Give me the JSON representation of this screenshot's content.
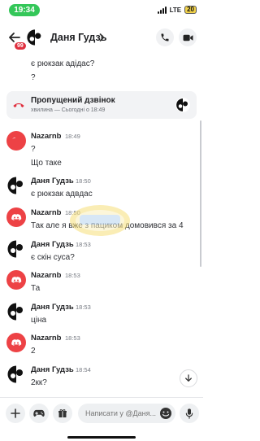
{
  "status": {
    "time": "19:34",
    "network": "LTE",
    "battery": "20"
  },
  "header": {
    "unread_count": "99",
    "title": "Даня Гудзь"
  },
  "continuation": [
    {
      "text": "є рюкзак адідас?"
    },
    {
      "text": "?"
    }
  ],
  "missed_call": {
    "title": "Пропущений дзвінок",
    "subtitle": "хвилина — Сьогодні о 18:49"
  },
  "messages": [
    {
      "author": "Nazarnb",
      "time": "18:49",
      "avatar": "discord-default-avatar",
      "lines": [
        "?",
        "Що таке"
      ]
    },
    {
      "author": "Даня Гудзь",
      "time": "18:50",
      "avatar": "contact-avatar",
      "lines": [
        "є рюкзак адвдас"
      ]
    },
    {
      "author": "Nazarnb",
      "time": "18:50",
      "avatar": "discord-default-avatar",
      "lines": [
        "Так але я вже з пациком домовився за 4"
      ]
    },
    {
      "author": "Даня Гудзь",
      "time": "18:53",
      "avatar": "contact-avatar",
      "lines": [
        "є скін суса?"
      ]
    },
    {
      "author": "Nazarnb",
      "time": "18:53",
      "avatar": "discord-default-avatar",
      "lines": [
        "Та"
      ]
    },
    {
      "author": "Даня Гудзь",
      "time": "18:53",
      "avatar": "contact-avatar",
      "lines": [
        "ціна"
      ]
    },
    {
      "author": "Nazarnb",
      "time": "18:53",
      "avatar": "discord-default-avatar",
      "lines": [
        "2"
      ]
    },
    {
      "author": "Даня Гудзь",
      "time": "18:54",
      "avatar": "contact-avatar",
      "lines": [
        "2кк?"
      ]
    }
  ],
  "composer": {
    "placeholder": "Написати у @Даня..."
  },
  "colors": {
    "discord_red": "#ed4245",
    "status_green": "#34c759",
    "badge_red": "#e0303f",
    "missed_call_red": "#e0303f"
  }
}
